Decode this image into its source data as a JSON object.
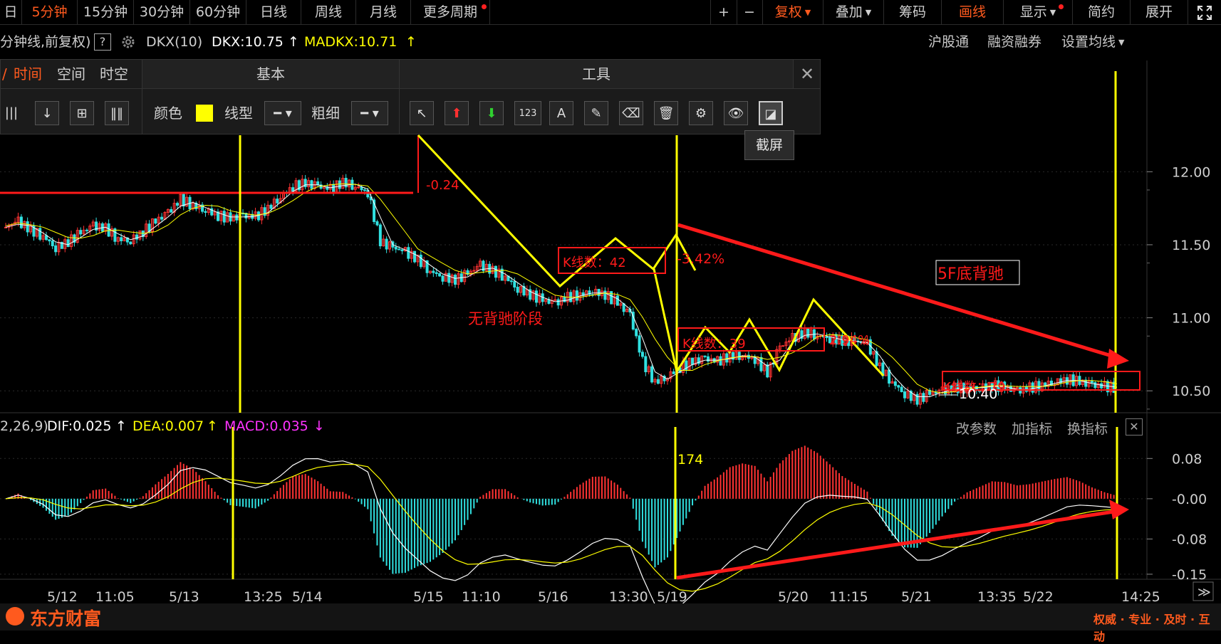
{
  "topbar": {
    "left_partial": "日",
    "periods": [
      "5分钟",
      "15分钟",
      "30分钟",
      "60分钟",
      "日线",
      "周线",
      "月线",
      "更多周期"
    ],
    "active_period": "5分钟",
    "plus": "+",
    "minus": "−",
    "fuquan": "复权",
    "diejia": "叠加",
    "chouma": "筹码",
    "huaxian": "画线",
    "xianshi": "显示",
    "jianyue": "简约",
    "zhankai": "展开"
  },
  "infobar": {
    "title": "分钟线,前复权)",
    "help": "?",
    "indicator": "DKX(10)",
    "dkx": "DKX:10.75",
    "madkx": "MADKX:10.71",
    "right_links": [
      "沪股通",
      "融资融券",
      "设置均线"
    ]
  },
  "toolpanel": {
    "tabs": [
      "时间",
      "空间",
      "时空"
    ],
    "section_basic": "基本",
    "section_tools": "工具",
    "color_label": "颜色",
    "linetype_label": "线型",
    "thickness_label": "粗细",
    "color_value": "#ffff00"
  },
  "tooltip": "截屏",
  "price_axis": [
    "12.00",
    "11.50",
    "11.00",
    "10.50"
  ],
  "macd_axis": [
    "0.08",
    "-0.00",
    "-0.08",
    "-0.15"
  ],
  "time_axis": [
    "5/12",
    "11:05",
    "5/13",
    "13:25",
    "5/14",
    "5/15",
    "11:10",
    "5/16",
    "13:30",
    "5/19",
    "5/20",
    "11:15",
    "5/21",
    "13:35",
    "5/22",
    "14:25"
  ],
  "annotations": {
    "pct1": "-0.24",
    "kcount1": "K线数：42",
    "pct2": "-3.42%",
    "phase": "无背驰阶段",
    "kcount2": "K线数：39",
    "pct3": "2.94%",
    "kcount3": "K线数：79",
    "low": "10.40",
    "divergence": "5F底背驰",
    "macd_count": "174"
  },
  "macd": {
    "params": "2,26,9)",
    "dif": "DIF:0.025",
    "dea": "DEA:0.007",
    "macd": "MACD:0.035",
    "links": [
      "改参数",
      "加指标",
      "换指标"
    ]
  },
  "footer": {
    "brand": "东方财富",
    "slogan": "权威 · 专业 · 及时 · 互动"
  },
  "colors": {
    "up": "#ff3333",
    "down": "#30e0e0",
    "yellow": "#ffff00",
    "accent": "#ff5a1e",
    "magenta": "#ff33ff"
  },
  "chart_data": {
    "type": "line",
    "price_range": [
      10.35,
      12.25
    ],
    "macd_range": [
      -0.16,
      0.12
    ],
    "close": [
      11.62,
      11.66,
      11.6,
      11.56,
      11.48,
      11.52,
      11.58,
      11.63,
      11.61,
      11.54,
      11.53,
      11.59,
      11.66,
      11.72,
      11.81,
      11.77,
      11.74,
      11.7,
      11.68,
      11.7,
      11.69,
      11.75,
      11.83,
      11.9,
      11.92,
      11.9,
      11.88,
      11.93,
      11.9,
      11.86,
      11.52,
      11.48,
      11.45,
      11.4,
      11.32,
      11.28,
      11.26,
      11.3,
      11.36,
      11.32,
      11.28,
      11.2,
      11.16,
      11.12,
      11.1,
      11.14,
      11.16,
      11.18,
      11.16,
      11.1,
      11.02,
      10.7,
      10.56,
      10.6,
      10.66,
      10.7,
      10.72,
      10.7,
      10.74,
      10.74,
      10.72,
      10.62,
      10.8,
      10.86,
      10.9,
      10.88,
      10.86,
      10.84,
      10.84,
      10.82,
      10.66,
      10.56,
      10.48,
      10.44,
      10.48,
      10.5,
      10.52,
      10.52,
      10.52,
      10.54,
      10.52,
      10.5,
      10.52,
      10.54,
      10.56,
      10.58,
      10.56,
      10.54,
      10.53,
      10.52
    ]
  }
}
